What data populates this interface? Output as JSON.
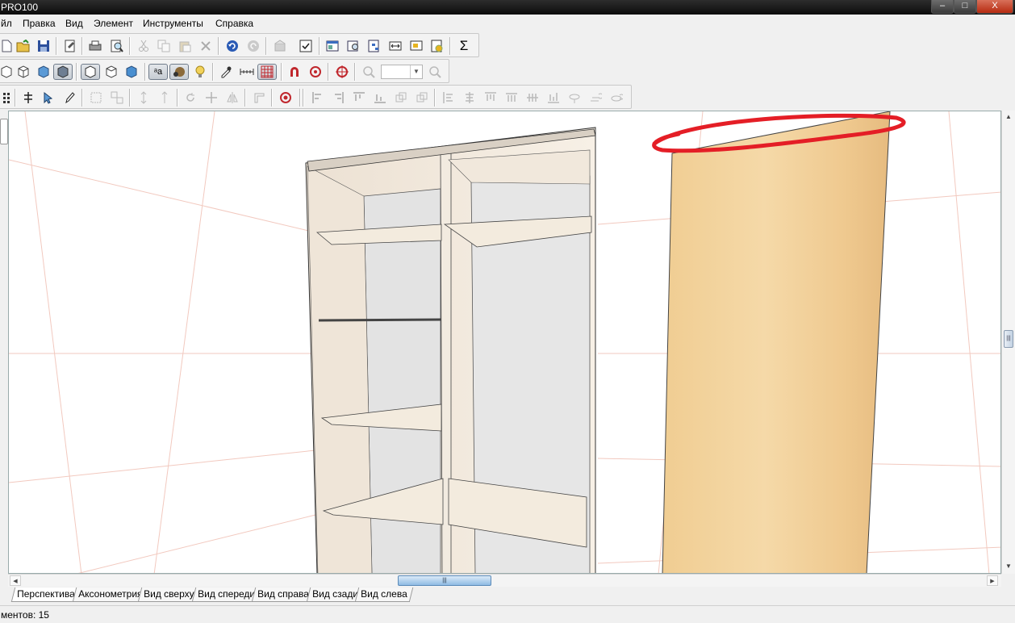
{
  "window": {
    "title": "PRO100",
    "minimize_label": "–",
    "maximize_label": "□",
    "close_label": "X"
  },
  "menu": {
    "items": [
      "йл",
      "Правка",
      "Вид",
      "Элемент",
      "Инструменты",
      "Справка"
    ]
  },
  "toolbar1": {
    "sum_label": "Σ"
  },
  "toolbar2": {
    "text_label": "ᵃa"
  },
  "colors": {
    "wood_panel": "#efc98f",
    "cabinet": "#f4ebe0",
    "annotation": "#e41e26"
  },
  "scroll": {
    "thumb_grip": "|||"
  },
  "tabs": [
    "Перспектива",
    "Аксонометрия",
    "Вид сверху",
    "Вид спереди",
    "Вид справа",
    "Вид сзади",
    "Вид слева"
  ],
  "status": {
    "text": "ментов: 15"
  }
}
